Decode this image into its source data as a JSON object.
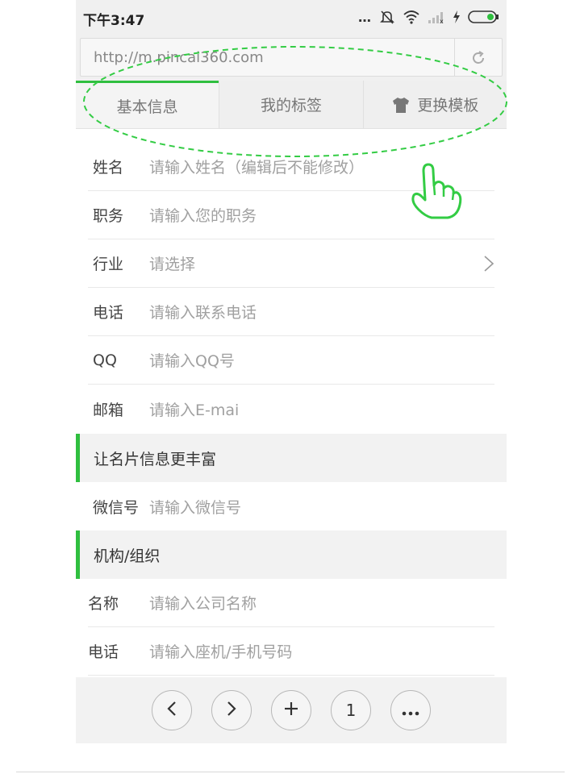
{
  "status_bar": {
    "time": "下午3:47",
    "icons": [
      "more-dots-icon",
      "mute-icon",
      "wifi-icon",
      "signal-icon",
      "charging-icon",
      "battery-icon"
    ]
  },
  "browser": {
    "url": "http://m.pincai360.com",
    "reload_icon": "reload-icon"
  },
  "tabs": [
    {
      "label": "基本信息",
      "active": true
    },
    {
      "label": "我的标签",
      "active": false
    },
    {
      "label": "更换模板",
      "active": false,
      "icon": "tshirt-icon"
    }
  ],
  "basic_fields": [
    {
      "label": "姓名",
      "placeholder": "请输入姓名（编辑后不能修改）"
    },
    {
      "label": "职务",
      "placeholder": "请输入您的职务"
    },
    {
      "label": "行业",
      "placeholder": "请选择",
      "icon": "chevron-right-icon"
    },
    {
      "label": "电话",
      "placeholder": "请输入联系电话"
    },
    {
      "label": "QQ",
      "placeholder": "请输入QQ号"
    },
    {
      "label": "邮箱",
      "placeholder": "请输入E-mai"
    }
  ],
  "section_rich": {
    "title": "让名片信息更丰富",
    "fields": [
      {
        "label": "微信号",
        "placeholder": "请输入微信号"
      }
    ]
  },
  "section_org": {
    "title": "机构/组织",
    "fields": [
      {
        "label": "名称",
        "placeholder": "请输入公司名称"
      },
      {
        "label": "电话",
        "placeholder": "请输入座机/手机号码"
      }
    ]
  },
  "toolbar": {
    "back_icon": "chevron-left-icon",
    "forward_icon": "chevron-right-icon",
    "new_tab_icon": "plus-icon",
    "tab_count": "1",
    "menu_icon": "more-icon"
  },
  "colors": {
    "accent": "#2fbf3f",
    "annotation": "#33cc44"
  }
}
